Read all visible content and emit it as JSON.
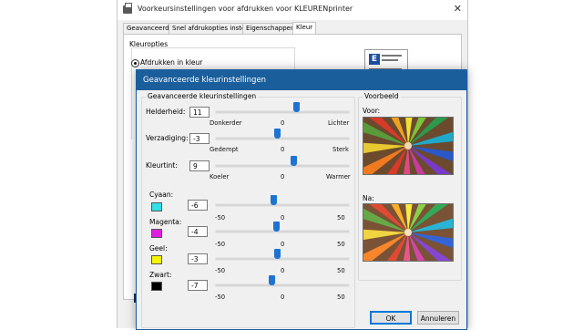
{
  "background_window": {
    "title": "Voorkeursinstellingen voor afdrukken voor KLEURENprinter",
    "tabs": [
      "Geavanceerd",
      "Snel afdrukopties instellen",
      "Eigenschappen",
      "Kleur"
    ],
    "active_tab": "Kleur",
    "section_label": "Kleuropties",
    "radio_label": "Afdrukken in kleur",
    "close_glyph": "✕"
  },
  "dialog": {
    "title": "Geavanceerde kleurinstellingen",
    "group_label": "Geavanceerde kleurinstellingen",
    "preview_label": "Voorbeeld",
    "before_label": "Voor:",
    "after_label": "Na:",
    "ok_label": "OK",
    "cancel_label": "Annuleren"
  },
  "controls": [
    {
      "label": "Helderheid:",
      "value": "11",
      "min_label": "Donkerder",
      "mid_label": "0",
      "max_label": "Lichter",
      "position": 0.61
    },
    {
      "label": "Verzadiging:",
      "value": "-3",
      "min_label": "Gedempt",
      "mid_label": "0",
      "max_label": "Sterk",
      "position": 0.47
    },
    {
      "label": "Kleurtint:",
      "value": "9",
      "min_label": "Koeler",
      "mid_label": "0",
      "max_label": "Warmer",
      "position": 0.59
    }
  ],
  "channels": [
    {
      "label": "Cyaan:",
      "value": "-6",
      "color": "#33e0e8",
      "min_label": "-50",
      "mid_label": "0",
      "max_label": "50",
      "position": 0.44
    },
    {
      "label": "Magenta:",
      "value": "-4",
      "color": "#e01ee0",
      "min_label": "-50",
      "mid_label": "0",
      "max_label": "50",
      "position": 0.46
    },
    {
      "label": "Geel:",
      "value": "-3",
      "color": "#f5f500",
      "min_label": "-50",
      "mid_label": "0",
      "max_label": "50",
      "position": 0.47
    },
    {
      "label": "Zwart:",
      "value": "-7",
      "color": "#000000",
      "min_label": "-50",
      "mid_label": "0",
      "max_label": "50",
      "position": 0.43
    }
  ],
  "colors": {
    "title_bar": "#1a5e9c",
    "slider_thumb": "#1e73d2",
    "dialog_bg": "#f0f0f0"
  }
}
